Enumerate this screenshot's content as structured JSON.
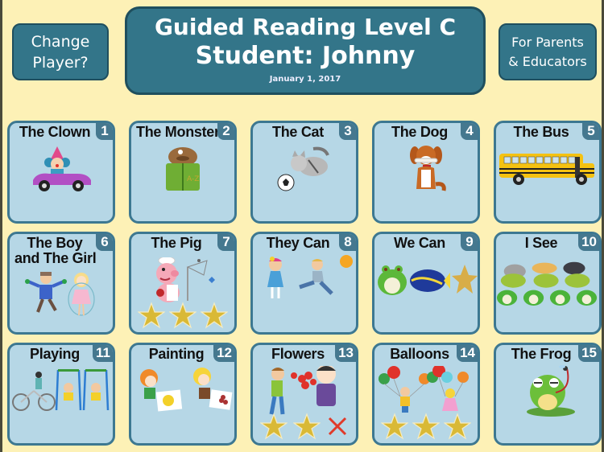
{
  "header": {
    "title_line1": "Guided Reading Level C",
    "title_line2": "Student: Johnny",
    "date": "January 1, 2017"
  },
  "buttons": {
    "change_player_line1": "Change",
    "change_player_line2": "Player?",
    "parents_line1": "For Parents",
    "parents_line2": "& Educators"
  },
  "colors": {
    "background": "#fdf1b6",
    "button": "#337589",
    "card": "#b6d7e6",
    "card_border": "#3d7891",
    "star": "#d9b936",
    "fail": "#e03a2a"
  },
  "books": [
    {
      "number": "1",
      "title": "The Clown",
      "title2": "",
      "illustration": "clown-in-car",
      "results": []
    },
    {
      "number": "2",
      "title": "The Monster",
      "title2": "",
      "illustration": "monster-reading-book",
      "results": []
    },
    {
      "number": "3",
      "title": "The Cat",
      "title2": "",
      "illustration": "kitten-with-soccer-ball",
      "results": []
    },
    {
      "number": "4",
      "title": "The Dog",
      "title2": "",
      "illustration": "dog-with-bone",
      "results": []
    },
    {
      "number": "5",
      "title": "The Bus",
      "title2": "",
      "illustration": "school-bus",
      "results": []
    },
    {
      "number": "6",
      "title": "The Boy",
      "title2": "and The Girl",
      "illustration": "boy-and-girl",
      "results": []
    },
    {
      "number": "7",
      "title": "The Pig",
      "title2": "",
      "illustration": "pig-with-net",
      "results": [
        "star",
        "star",
        "star"
      ]
    },
    {
      "number": "8",
      "title": "They Can",
      "title2": "",
      "illustration": "girl-and-running-boy",
      "results": []
    },
    {
      "number": "9",
      "title": "We Can",
      "title2": "",
      "illustration": "frog-fish-star",
      "results": []
    },
    {
      "number": "10",
      "title": "I See",
      "title2": "",
      "illustration": "animals-on-turtles-and-frogs",
      "results": []
    },
    {
      "number": "11",
      "title": "Playing",
      "title2": "",
      "illustration": "bike-and-swings",
      "results": []
    },
    {
      "number": "12",
      "title": "Painting",
      "title2": "",
      "illustration": "kids-painting",
      "results": []
    },
    {
      "number": "13",
      "title": "Flowers",
      "title2": "",
      "illustration": "boy-giving-flowers",
      "results": [
        "star",
        "star",
        "x"
      ]
    },
    {
      "number": "14",
      "title": "Balloons",
      "title2": "",
      "illustration": "kids-with-balloons",
      "results": [
        "star",
        "star",
        "star"
      ]
    },
    {
      "number": "15",
      "title": "The Frog",
      "title2": "",
      "illustration": "frog-catching-fly",
      "results": []
    }
  ]
}
